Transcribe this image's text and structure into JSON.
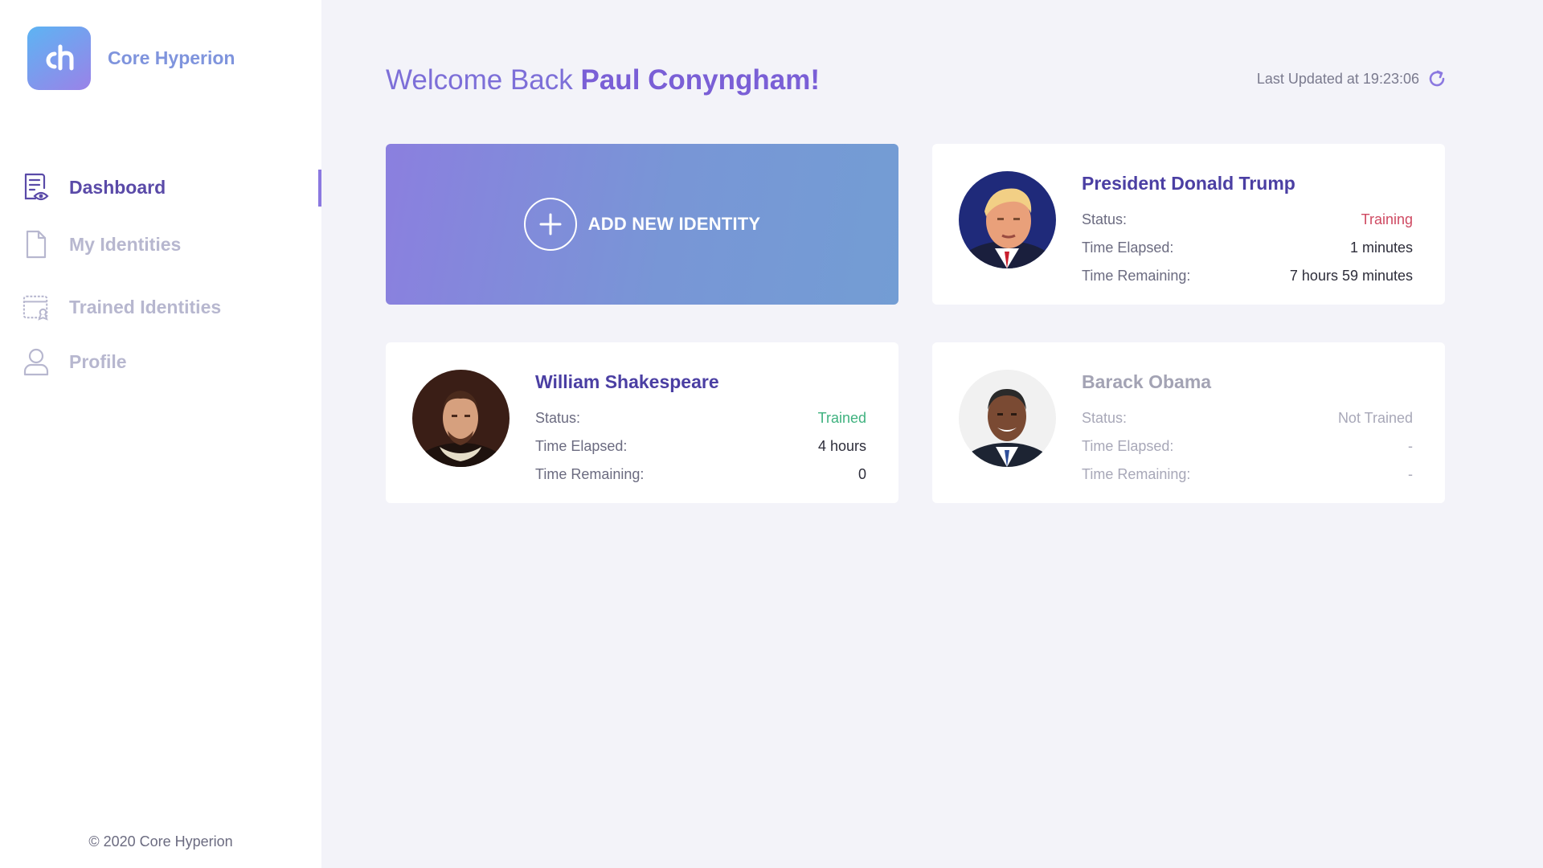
{
  "brand": {
    "name": "Core Hyperion",
    "logo_text": "ch"
  },
  "nav": {
    "items": [
      {
        "label": "Dashboard",
        "icon": "dashboard-icon",
        "active": true
      },
      {
        "label": "My Identities",
        "icon": "file-icon",
        "active": false
      },
      {
        "label": "Trained Identities",
        "icon": "trained-icon",
        "active": false
      },
      {
        "label": "Profile",
        "icon": "user-icon",
        "active": false
      }
    ]
  },
  "footer": {
    "copyright": "© 2020 Core Hyperion"
  },
  "header": {
    "welcome_prefix": "Welcome Back",
    "user_name": "Paul Conyngham!",
    "last_updated": "Last Updated at 19:23:06"
  },
  "add_card": {
    "label": "ADD NEW IDENTITY"
  },
  "labels": {
    "status": "Status:",
    "elapsed": "Time Elapsed:",
    "remaining": "Time Remaining:"
  },
  "identities": [
    {
      "name": "President Donald Trump",
      "status": "Training",
      "elapsed": "1 minutes",
      "remaining": "7 hours 59 minutes",
      "status_color": "#cf4a62"
    },
    {
      "name": "William Shakespeare",
      "status": "Trained",
      "elapsed": "4 hours",
      "remaining": "0",
      "status_color": "#3fb27f"
    },
    {
      "name": "Barack Obama",
      "status": "Not Trained",
      "elapsed": "-",
      "remaining": "-",
      "status_color": "#a8a8b8"
    }
  ],
  "colors": {
    "accent": "#7a5fd6",
    "sidebar_active": "#5a4aa8",
    "sidebar_inactive": "#b7b7cf",
    "background": "#f3f3f9"
  }
}
